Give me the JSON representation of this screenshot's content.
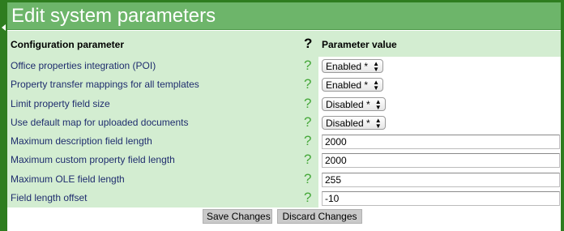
{
  "title": "Edit system parameters",
  "header": {
    "parameter_label": "Configuration parameter",
    "help_glyph": "?",
    "value_label": "Parameter value"
  },
  "rows": [
    {
      "label": "Office properties integration (POI)",
      "help": "?",
      "type": "select",
      "value": "Enabled *"
    },
    {
      "label": "Property transfer mappings for all templates",
      "help": "?",
      "type": "select",
      "value": "Enabled *"
    },
    {
      "label": "Limit property field size",
      "help": "?",
      "type": "select",
      "value": "Disabled *"
    },
    {
      "label": "Use default map for uploaded documents",
      "help": "?",
      "type": "select",
      "value": "Disabled *"
    },
    {
      "label": "Maximum description field length",
      "help": "?",
      "type": "text",
      "value": "2000"
    },
    {
      "label": "Maximum custom property field length",
      "help": "?",
      "type": "text",
      "value": "2000"
    },
    {
      "label": "Maximum OLE field length",
      "help": "?",
      "type": "text",
      "value": "255"
    },
    {
      "label": "Field length offset",
      "help": "?",
      "type": "text",
      "value": "-10"
    }
  ],
  "buttons": {
    "save": "Save Changes",
    "discard": "Discard Changes"
  },
  "colors": {
    "outer_green": "#2e7d1f",
    "title_green": "#6db56a",
    "row_green": "#d3edd1",
    "label_blue": "#1f2d6e",
    "help_green": "#46a83a"
  },
  "icons": {
    "select_arrows": "up-down-arrows-icon",
    "help": "question-mark-icon"
  }
}
